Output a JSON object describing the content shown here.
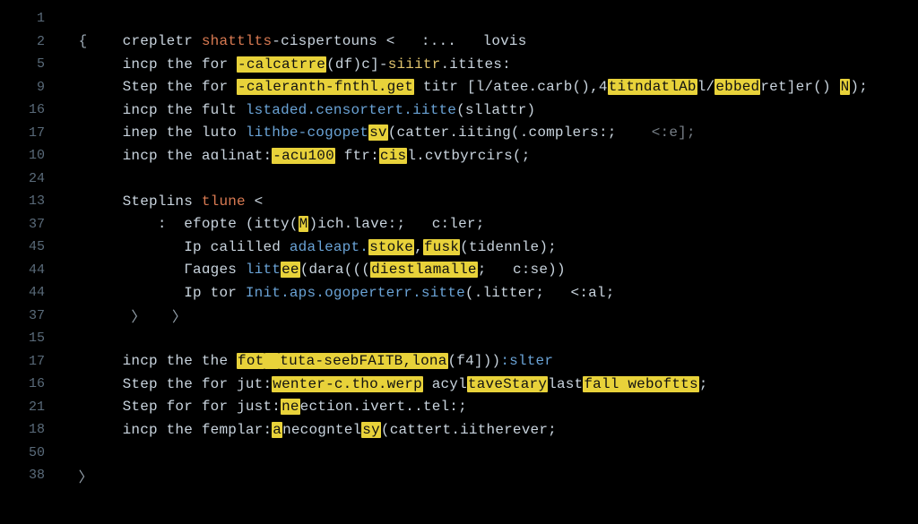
{
  "gutter": [
    "1",
    "2",
    "5",
    "9",
    "16",
    "17",
    "10",
    "24",
    "13",
    "37",
    "45",
    "44",
    "44",
    "37",
    "15",
    "17",
    "16",
    "21",
    "18",
    "50",
    "38"
  ],
  "l2": {
    "brace": "{",
    "t1": "crepletr ",
    "kw": "shattlts",
    "t2": "-cispertouns <   :...   lovis"
  },
  "l5": {
    "a": "incp the for ",
    "hl1": "-calcatrre",
    "b": "(df)c]-",
    "c": "siiitr",
    "d": ".itites:"
  },
  "l9": {
    "a": "Step the for ",
    "hl1": "-caleranth-fnthl.get",
    "b": " titr [l/atee.carb(),4",
    "hl2": "titndatlAb",
    "c": "l/",
    "hl3": "ebbed",
    "d": "ret]er() ",
    "hl4": "N",
    "e": ");"
  },
  "l16a": {
    "a": "incp the fult ",
    "b": "lstaded.censortert.iitte",
    "c": "(sllattr)"
  },
  "l17a": {
    "a": "inep the luto ",
    "b": "lithbe-cogopet",
    "hl1": "sv",
    "c": "(catter.iiting(.complers:;",
    "d": "    <:e];"
  },
  "l10": {
    "a": "incp the aɑlinat:",
    "hl1": "-acu100",
    "b": " ftr:",
    "hl2": "cis",
    "c": "l.cvtbyrcirs(;"
  },
  "l13": {
    "a": "Steplins ",
    "kw": "tlune",
    "b": " <"
  },
  "l37a": {
    "a": ":  efopte (itty(",
    "hl1": "M",
    "b": ")ich.lave:;   c:ler;"
  },
  "l45": {
    "a": "Ip calilled ",
    "b": "adaleapt.",
    "hl1": "stoke",
    "c": ",",
    "hl2": "fusk",
    "d": "(tidennle);"
  },
  "l44a": {
    "a": "Γaɑɡes ",
    "b": "litt",
    "hl1": "ee",
    "c": "(dara(((",
    "hl2": "diestlamalle",
    "d": ";   c:se))"
  },
  "l44b": {
    "a": "Ip tor ",
    "b": "Init.aps.ogoperterr.sitte",
    "c": "(.litter;   <:al;"
  },
  "l37b": {
    "a": "〉   〉"
  },
  "l17b": {
    "a": "incp the the ",
    "hl1": "fot",
    "sp": " ",
    "hl2": "tuta-seebFAITB,lona",
    "b": "(f4]))",
    "c": ":slter"
  },
  "l16b": {
    "a": "Step the for jut:",
    "hl1": "wenter-c.tho.werp",
    "b": " acyl",
    "hl2": "taveStary",
    "c": "last",
    "hl3": "fall weboftts",
    "d": ";"
  },
  "l21": {
    "a": "Step for for just:",
    "hl1": "ne",
    "b": "ection.ivert..tel:;"
  },
  "l18": {
    "a": "incp the femplar:",
    "hl1": "a",
    "b": "necogntel",
    "hl2": "sy",
    "c": "(cattert.iitherever;"
  },
  "l38": {
    "a": "〉"
  }
}
